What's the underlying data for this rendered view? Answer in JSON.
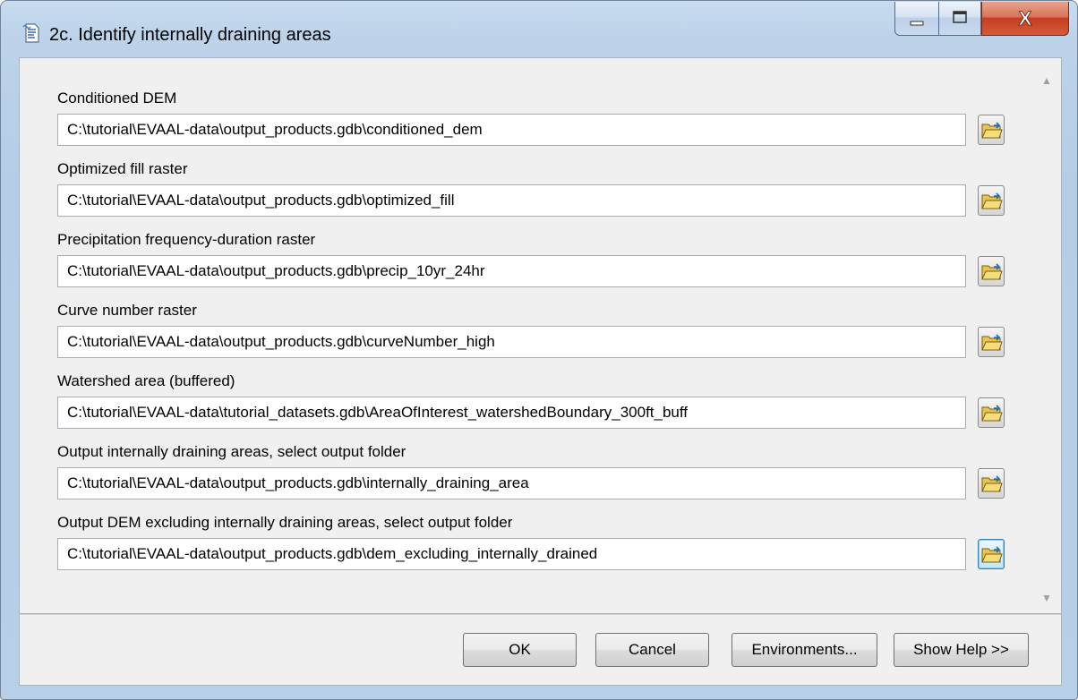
{
  "window": {
    "title": "2c. Identify internally draining areas"
  },
  "fields": [
    {
      "label": "Conditioned DEM",
      "value": "C:\\tutorial\\EVAAL-data\\output_products.gdb\\conditioned_dem"
    },
    {
      "label": "Optimized fill raster",
      "value": "C:\\tutorial\\EVAAL-data\\output_products.gdb\\optimized_fill"
    },
    {
      "label": "Precipitation frequency-duration raster",
      "value": "C:\\tutorial\\EVAAL-data\\output_products.gdb\\precip_10yr_24hr"
    },
    {
      "label": "Curve number raster",
      "value": "C:\\tutorial\\EVAAL-data\\output_products.gdb\\curveNumber_high"
    },
    {
      "label": "Watershed area (buffered)",
      "value": "C:\\tutorial\\EVAAL-data\\tutorial_datasets.gdb\\AreaOfInterest_watershedBoundary_300ft_buff"
    },
    {
      "label": "Output internally draining areas, select output folder",
      "value": "C:\\tutorial\\EVAAL-data\\output_products.gdb\\internally_draining_area"
    },
    {
      "label": "Output DEM excluding internally draining areas, select output folder",
      "value": "C:\\tutorial\\EVAAL-data\\output_products.gdb\\dem_excluding_internally_drained"
    }
  ],
  "buttons": {
    "ok": "OK",
    "cancel": "Cancel",
    "environments": "Environments...",
    "help": "Show Help >>"
  },
  "caption": {
    "close": "X"
  },
  "icons": {
    "title": "toolbox-script-icon",
    "browse": "open-folder-icon",
    "scroll_up": "scroll-up-arrow-icon",
    "scroll_down": "scroll-down-arrow-icon"
  },
  "colors": {
    "frame": "#bcd3ea",
    "client": "#f0f0f0",
    "close_button": "#c63d22",
    "focus": "#3c7fb1"
  }
}
